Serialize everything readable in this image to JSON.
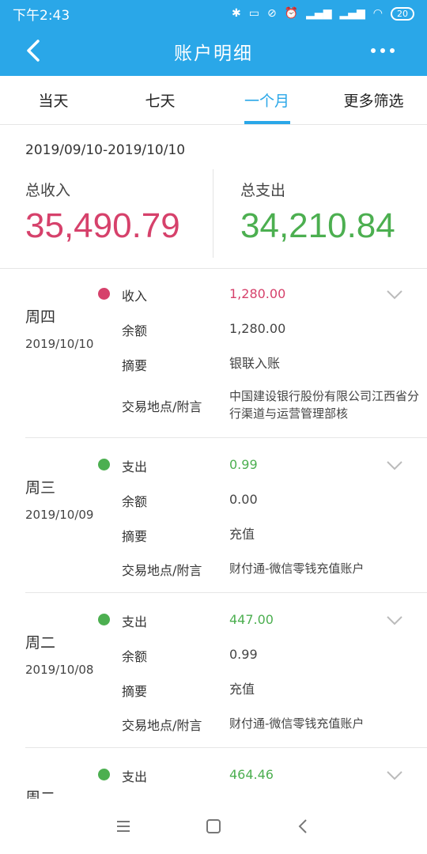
{
  "status_bar": {
    "time": "下午2:43",
    "battery": "20"
  },
  "app_bar": {
    "title": "账户明细"
  },
  "tabs": [
    {
      "label": "当天",
      "active": false
    },
    {
      "label": "七天",
      "active": false
    },
    {
      "label": "一个月",
      "active": true
    },
    {
      "label": "更多筛选",
      "active": false
    }
  ],
  "summary": {
    "date_range": "2019/09/10-2019/10/10",
    "income_label": "总收入",
    "income_value": "35,490.79",
    "expense_label": "总支出",
    "expense_value": "34,210.84"
  },
  "labels": {
    "type": "收入",
    "balance": "余额",
    "summary": "摘要",
    "location": "交易地点/附言"
  },
  "records": [
    {
      "weekday": "周四",
      "date": "2019/10/10",
      "type": "收入",
      "amount": "1,280.00",
      "balance": "1,280.00",
      "summary": "银联入账",
      "location": "中国建设银行股份有限公司江西省分行渠道与运营管理部核",
      "color": "#d6416b"
    },
    {
      "weekday": "周三",
      "date": "2019/10/09",
      "type": "支出",
      "amount": "0.99",
      "balance": "0.00",
      "summary": "充值",
      "location": "财付通-微信零钱充值账户",
      "color": "#4caf50"
    },
    {
      "weekday": "周二",
      "date": "2019/10/08",
      "type": "支出",
      "amount": "447.00",
      "balance": "0.99",
      "summary": "充值",
      "location": "财付通-微信零钱充值账户",
      "color": "#4caf50"
    },
    {
      "weekday": "周二",
      "date": "",
      "type": "支出",
      "amount": "464.46",
      "balance": "",
      "summary": "",
      "location": "",
      "color": "#4caf50"
    }
  ],
  "colors": {
    "accent": "#2aa7e8",
    "income": "#d6416b",
    "expense": "#4caf50"
  }
}
